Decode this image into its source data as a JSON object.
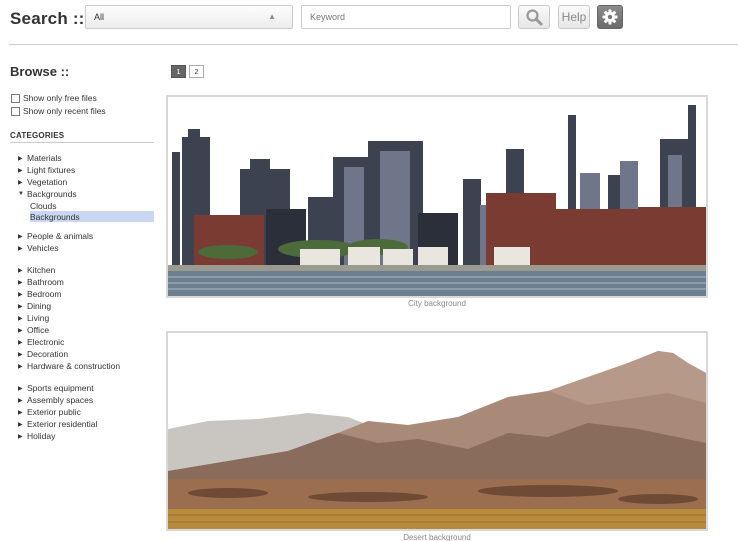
{
  "header": {
    "search_title": "Search ::",
    "category_select": "All",
    "keyword_placeholder": "Keyword",
    "help_label": "Help"
  },
  "sidebar": {
    "browse_title": "Browse ::",
    "filters": [
      {
        "label": "Show only free files",
        "checked": false
      },
      {
        "label": "Show only recent files",
        "checked": false
      }
    ],
    "categories_heading": "CATEGORIES",
    "groups": [
      [
        {
          "label": "Materials"
        },
        {
          "label": "Light fixtures"
        },
        {
          "label": "Vegetation"
        },
        {
          "label": "Backgrounds",
          "expanded": true,
          "children": [
            {
              "label": "Clouds",
              "active": false
            },
            {
              "label": "Backgrounds",
              "active": true
            }
          ]
        }
      ],
      [
        {
          "label": "People & animals"
        },
        {
          "label": "Vehicles"
        }
      ],
      [
        {
          "label": "Kitchen"
        },
        {
          "label": "Bathroom"
        },
        {
          "label": "Bedroom"
        },
        {
          "label": "Dining"
        },
        {
          "label": "Living"
        },
        {
          "label": "Office"
        },
        {
          "label": "Electronic"
        },
        {
          "label": "Decoration"
        },
        {
          "label": "Hardware & construction"
        }
      ],
      [
        {
          "label": "Sports equipment"
        },
        {
          "label": "Assembly spaces"
        },
        {
          "label": "Exterior public"
        },
        {
          "label": "Exterior residential"
        },
        {
          "label": "Holiday"
        }
      ]
    ]
  },
  "pagination": {
    "pages": [
      "1",
      "2"
    ],
    "current": "1"
  },
  "results": [
    {
      "caption": "City background",
      "image": "city-skyline-image"
    },
    {
      "caption": "Desert background",
      "image": "desert-mountains-image"
    }
  ]
}
